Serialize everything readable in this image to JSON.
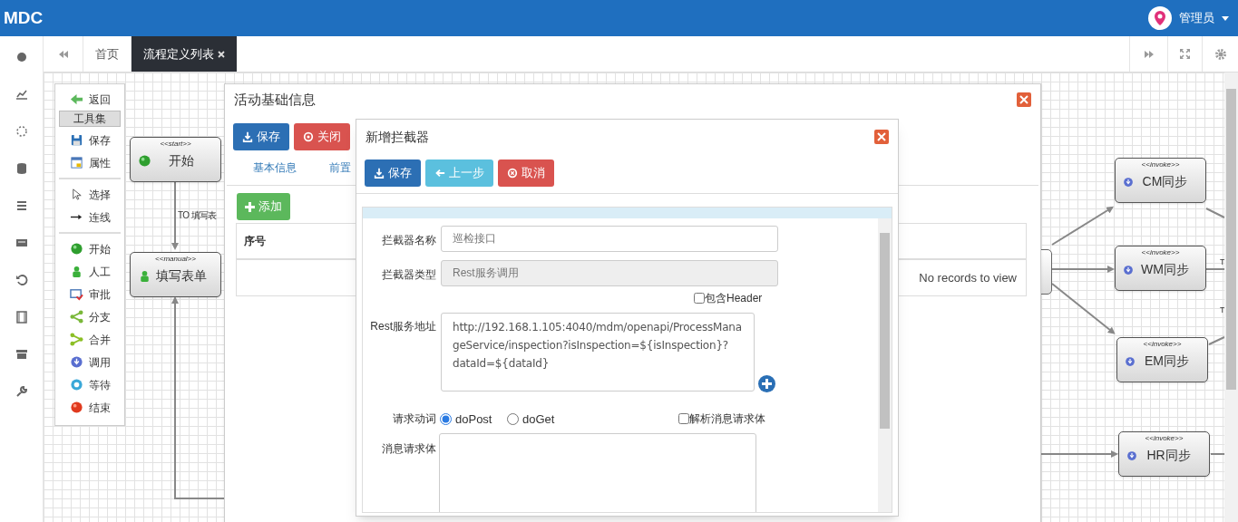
{
  "header": {
    "logo": "MDC",
    "user": "管理员"
  },
  "tabs": [
    {
      "label": "首页",
      "selected": false,
      "closable": false
    },
    {
      "label": "流程定义列表",
      "selected": true,
      "closable": true
    }
  ],
  "toolbox": {
    "back": "返回",
    "title": "工具集",
    "groups": [
      [
        {
          "kind": "save",
          "label": "保存"
        },
        {
          "kind": "props",
          "label": "属性"
        }
      ],
      [
        {
          "kind": "select",
          "label": "选择"
        },
        {
          "kind": "connect",
          "label": "连线"
        }
      ],
      [
        {
          "kind": "start",
          "label": "开始"
        },
        {
          "kind": "manual",
          "label": "人工"
        },
        {
          "kind": "approve",
          "label": "审批"
        },
        {
          "kind": "fork",
          "label": "分支"
        },
        {
          "kind": "join",
          "label": "合并"
        },
        {
          "kind": "invoke",
          "label": "调用"
        },
        {
          "kind": "wait",
          "label": "等待"
        },
        {
          "kind": "end",
          "label": "结束"
        }
      ]
    ]
  },
  "diagram": {
    "nodes": [
      {
        "kind": "start",
        "stereotype": "<<start>>",
        "label": "开始"
      },
      {
        "kind": "manual",
        "stereotype": "<<manual>>",
        "label": "填写表单"
      },
      {
        "kind": "invoke",
        "stereotype": "<<invoke>>",
        "label": "CM同步"
      },
      {
        "kind": "invoke",
        "stereotype": "<<invoke>>",
        "label": "WM同步"
      },
      {
        "kind": "invoke",
        "stereotype": "<<invoke>>",
        "label": "EM同步"
      },
      {
        "kind": "invoke",
        "stereotype": "<<invoke>>",
        "label": "HR同步"
      }
    ],
    "edge_labels": [
      "TO 填写表",
      "T",
      "T"
    ]
  },
  "activity_dialog": {
    "title": "活动基础信息",
    "buttons": [
      {
        "kind": "save",
        "label": "保存"
      },
      {
        "kind": "close",
        "label": "关闭"
      }
    ],
    "tabs": [
      "基本信息",
      "前置"
    ],
    "add_button": "添加",
    "table": {
      "columns": [
        "序号"
      ],
      "empty_text": "No records to view"
    }
  },
  "interceptor_dialog": {
    "title": "新增拦截器",
    "buttons": [
      {
        "kind": "save",
        "label": "保存"
      },
      {
        "kind": "back",
        "label": "上一步"
      },
      {
        "kind": "cancel",
        "label": "取消"
      }
    ],
    "name_field": {
      "label": "拦截器名称",
      "value": "巡检接口"
    },
    "type_field": {
      "label": "拦截器类型",
      "value": "Rest服务调用",
      "disabled": true
    },
    "include_header": {
      "label": "包含Header",
      "checked": false
    },
    "url_field": {
      "label": "Rest服务地址",
      "value": "http://192.168.1.105:4040/mdm/openapi/ProcessManageService/inspection?isInspection=${isInspection}?dataId=${dataId}"
    },
    "verb": {
      "label": "请求动词",
      "options": [
        {
          "label": "doPost",
          "selected": true
        },
        {
          "label": "doGet",
          "selected": false
        }
      ]
    },
    "parse_body": {
      "label": "解析消息请求体",
      "checked": false
    },
    "body_field": {
      "label": "消息请求体"
    }
  }
}
